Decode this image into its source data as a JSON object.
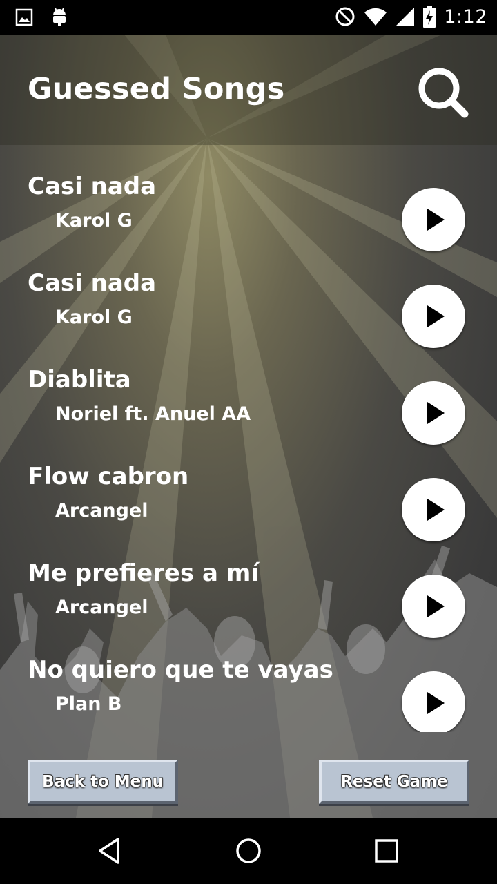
{
  "status_bar": {
    "time": "1:12",
    "icons": [
      "image-icon",
      "android-icon",
      "do-not-disturb-icon",
      "wifi-icon",
      "signal-icon",
      "battery-charging-icon"
    ]
  },
  "header": {
    "title": "Guessed Songs",
    "search_icon": "search-icon"
  },
  "songs": [
    {
      "title": "Casi nada",
      "artist": "Karol G"
    },
    {
      "title": "Casi nada",
      "artist": "Karol G"
    },
    {
      "title": "Diablita",
      "artist": "Noriel ft. Anuel AA"
    },
    {
      "title": "Flow cabron",
      "artist": "Arcangel"
    },
    {
      "title": "Me prefieres a mí",
      "artist": "Arcangel"
    },
    {
      "title": "No quiero que te vayas",
      "artist": "Plan B"
    }
  ],
  "buttons": {
    "back": "Back to Menu",
    "reset": "Reset Game"
  },
  "nav_bar": {
    "icons": [
      "back-icon",
      "home-icon",
      "recents-icon"
    ]
  }
}
